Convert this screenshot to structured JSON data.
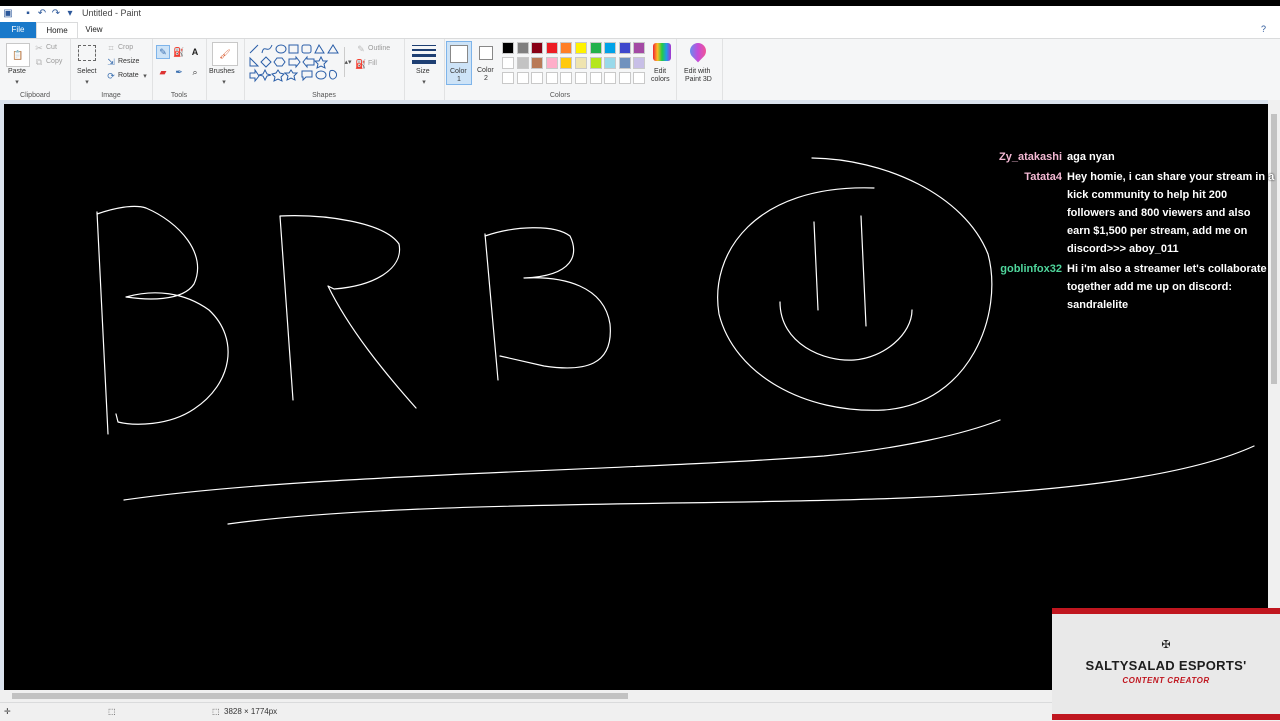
{
  "window": {
    "title": "Untitled - Paint"
  },
  "menu": {
    "file": "File",
    "home": "Home",
    "view": "View"
  },
  "ribbon": {
    "clipboard": {
      "paste": "Paste",
      "cut": "Cut",
      "copy": "Copy",
      "label": "Clipboard"
    },
    "image": {
      "select": "Select",
      "crop": "Crop",
      "resize": "Resize",
      "rotate": "Rotate",
      "label": "Image"
    },
    "tools": {
      "label": "Tools"
    },
    "brushes": {
      "label": "Brushes"
    },
    "shapes": {
      "outline": "Outline",
      "fill": "Fill",
      "label": "Shapes"
    },
    "size": {
      "label": "Size"
    },
    "color1": {
      "label": "Color",
      "num": "1"
    },
    "color2": {
      "label": "Color",
      "num": "2"
    },
    "colors": {
      "label": "Colors",
      "row1": [
        "#000000",
        "#7f7f7f",
        "#880015",
        "#ed1c24",
        "#ff7f27",
        "#fff200",
        "#22b14c",
        "#00a2e8",
        "#3f48cc",
        "#a349a4"
      ],
      "row2": [
        "#ffffff",
        "#c3c3c3",
        "#b97a57",
        "#ffaec9",
        "#ffc90e",
        "#efe4b0",
        "#b5e61d",
        "#99d9ea",
        "#7092be",
        "#c8bfe7"
      ],
      "row3": [
        "#ffffff",
        "#ffffff",
        "#ffffff",
        "#ffffff",
        "#ffffff",
        "#ffffff",
        "#ffffff",
        "#ffffff",
        "#ffffff",
        "#ffffff"
      ]
    },
    "edit_colors": {
      "line1": "Edit",
      "line2": "colors"
    },
    "paint3d": {
      "line1": "Edit with",
      "line2": "Paint 3D"
    }
  },
  "canvas": {
    "drawing_text": "BRB",
    "background": "#000000",
    "stroke": "#ffffff"
  },
  "chat": [
    {
      "user": "Zy_atakashi",
      "color": "#f4b9d4",
      "message": "aga nyan"
    },
    {
      "user": "Tatata4",
      "color": "#f4b9d4",
      "message": "Hey homie, i can share your stream in a kick community to help hit 200 followers and 800 viewers and also earn $1,500 per stream, add me on discord>>> aboy_011"
    },
    {
      "user": "goblinfox32",
      "color": "#4fd69c",
      "message": "Hi i'm also a streamer let's collaborate together add me up on discord: sandralelite"
    }
  ],
  "overlay": {
    "brand": "SALTYSALAD ESPORTS'",
    "subtitle": "CONTENT CREATOR",
    "accent": "#c0161f"
  },
  "status": {
    "dimensions": "3828 × 1774px"
  }
}
